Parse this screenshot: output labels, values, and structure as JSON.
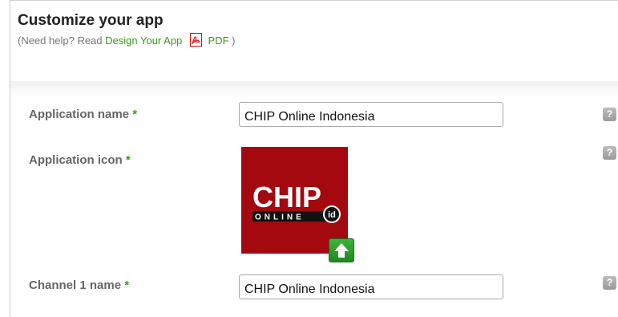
{
  "header": {
    "title": "Customize your app",
    "help_prefix": "(Need help? Read",
    "help_link": "Design Your App",
    "pdf_label": "PDF",
    "help_suffix": ")"
  },
  "form": {
    "required_mark": "*",
    "help_button": "?",
    "app_name": {
      "label": "Application name",
      "value": "CHIP Online Indonesia"
    },
    "app_icon": {
      "label": "Application icon",
      "logo_text": "CHIP",
      "logo_subtext": "ONLINE",
      "logo_badge": "id"
    },
    "channel1": {
      "label": "Channel 1 name",
      "value": "CHIP Online Indonesia"
    }
  },
  "colors": {
    "accent": "#3a9a1a",
    "logo_bg": "#a3090f",
    "upload": "#2ea32c"
  }
}
